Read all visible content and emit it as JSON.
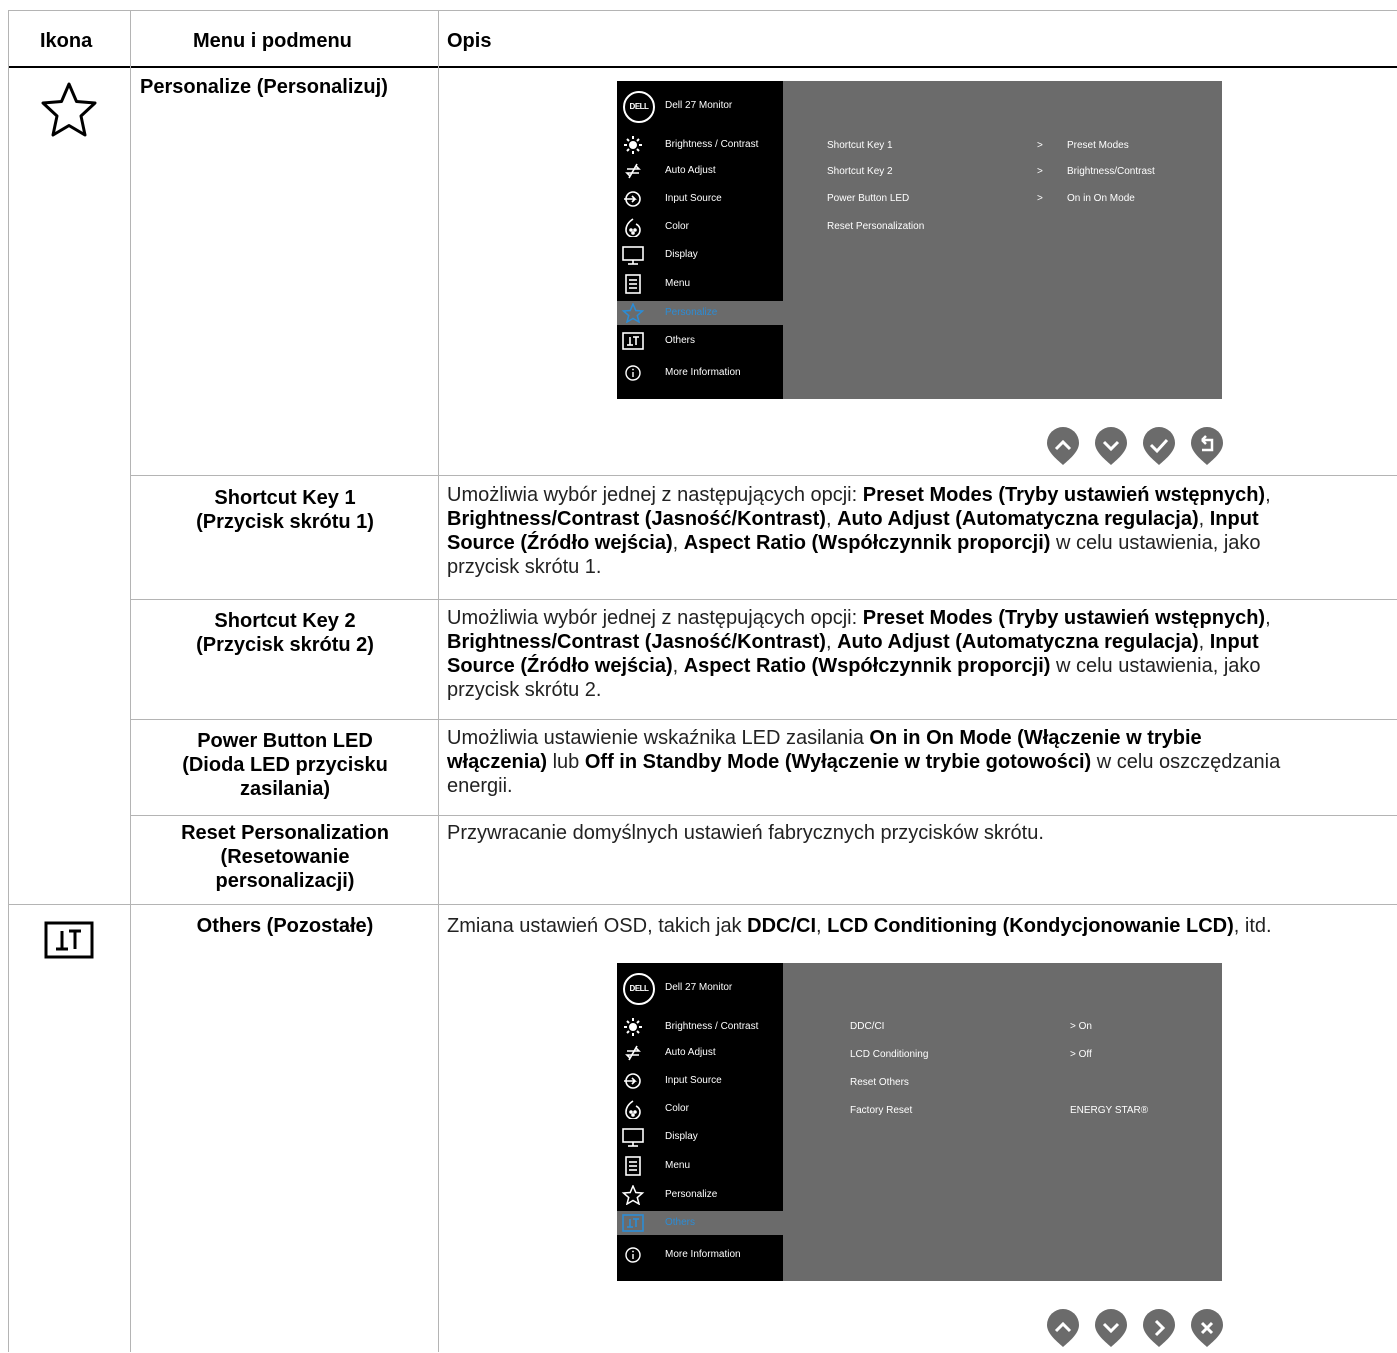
{
  "table": {
    "headers": {
      "icon": "Ikona",
      "menu": "Menu i podmenu",
      "desc": "Opis"
    },
    "personalize": {
      "icon": "star-icon",
      "title": "Personalize (Personalizuj)"
    },
    "rows": [
      {
        "name_l1": "Shortcut Key 1",
        "name_l2": "(Przycisk skrótu 1)",
        "desc_lines": [
          [
            [
              "Umożliwia wybór jednej z następujących opcji: ",
              false
            ],
            [
              "Preset Modes (Tryby ustawień wstępnych)",
              true
            ],
            [
              ",",
              false
            ]
          ],
          [
            [
              "Brightness/Contrast (Jasność/Kontrast)",
              true
            ],
            [
              ", ",
              false
            ],
            [
              "Auto Adjust (Automatyczna regulacja)",
              true
            ],
            [
              ", ",
              false
            ],
            [
              "Input",
              true
            ]
          ],
          [
            [
              "Source (Źródło wejścia)",
              true
            ],
            [
              ", ",
              false
            ],
            [
              "Aspect Ratio (Współczynnik proporcji)",
              true
            ],
            [
              " w celu ustawienia, jako",
              false
            ]
          ],
          [
            [
              "przycisk skrótu 1.",
              false
            ]
          ]
        ]
      },
      {
        "name_l1": "Shortcut Key 2",
        "name_l2": "(Przycisk skrótu 2)",
        "desc_lines": [
          [
            [
              "Umożliwia wybór jednej z następujących opcji: ",
              false
            ],
            [
              "Preset Modes (Tryby ustawień wstępnych)",
              true
            ],
            [
              ",",
              false
            ]
          ],
          [
            [
              "Brightness/Contrast (Jasność/Kontrast)",
              true
            ],
            [
              ", ",
              false
            ],
            [
              "Auto Adjust (Automatyczna regulacja)",
              true
            ],
            [
              ", ",
              false
            ],
            [
              "Input",
              true
            ]
          ],
          [
            [
              "Source (Źródło wejścia)",
              true
            ],
            [
              ", ",
              false
            ],
            [
              "Aspect Ratio (Współczynnik proporcji)",
              true
            ],
            [
              " w celu ustawienia, jako",
              false
            ]
          ],
          [
            [
              "przycisk skrótu 2.",
              false
            ]
          ]
        ]
      },
      {
        "name_l1": "Power Button LED",
        "name_l2": "(Dioda LED przycisku",
        "name_l3": "zasilania)",
        "desc_lines": [
          [
            [
              "Umożliwia ustawienie wskaźnika LED zasilania ",
              false
            ],
            [
              "On in On Mode (Włączenie w trybie",
              true
            ]
          ],
          [
            [
              "włączenia)",
              true
            ],
            [
              " lub ",
              false
            ],
            [
              "Off in Standby Mode (Wyłączenie w trybie gotowości)",
              true
            ],
            [
              " w celu oszczędzania",
              false
            ]
          ],
          [
            [
              "energii.",
              false
            ]
          ]
        ]
      },
      {
        "name_l1": "Reset Personalization",
        "name_l2": "(Resetowanie",
        "name_l3": "personalizacji)",
        "desc_lines": [
          [
            [
              "Przywracanie domyślnych ustawień fabrycznych przycisków skrótu.",
              false
            ]
          ]
        ]
      }
    ],
    "others": {
      "icon": "others-icon",
      "title": "Others (Pozostałe)",
      "desc_lines": [
        [
          [
            "Zmiana ustawień OSD, takich jak ",
            false
          ],
          [
            "DDC/CI",
            true
          ],
          [
            ", ",
            false
          ],
          [
            "LCD Conditioning (Kondycjonowanie LCD)",
            true
          ],
          [
            ", itd.",
            false
          ]
        ]
      ]
    }
  },
  "osd1": {
    "logo": "DELL",
    "title": "Dell 27 Monitor",
    "menu": [
      "Brightness / Contrast",
      "Auto Adjust",
      "Input Source",
      "Color",
      "Display",
      "Menu",
      "Personalize",
      "Others",
      "More Information"
    ],
    "selected_index": 6,
    "options": [
      {
        "label": "Shortcut Key 1",
        "arrow": ">",
        "value": "Preset Modes"
      },
      {
        "label": "Shortcut Key 2",
        "arrow": ">",
        "value": "Brightness/Contrast"
      },
      {
        "label": "Power Button LED",
        "arrow": ">",
        "value": "On in On Mode"
      },
      {
        "label": "Reset Personalization",
        "arrow": "",
        "value": ""
      }
    ],
    "nav_buttons": [
      "up-icon",
      "down-icon",
      "check-icon",
      "back-icon"
    ]
  },
  "osd2": {
    "logo": "DELL",
    "title": "Dell 27 Monitor",
    "menu": [
      "Brightness / Contrast",
      "Auto Adjust",
      "Input Source",
      "Color",
      "Display",
      "Menu",
      "Personalize",
      "Others",
      "More Information"
    ],
    "selected_index": 7,
    "options": [
      {
        "label": "DDC/CI",
        "value": "> On"
      },
      {
        "label": "LCD Conditioning",
        "value": "> Off"
      },
      {
        "label": "Reset Others",
        "value": ""
      },
      {
        "label": "Factory Reset",
        "value": "ENERGY STAR®"
      }
    ],
    "nav_buttons": [
      "up-icon",
      "down-icon",
      "right-icon",
      "close-icon"
    ]
  },
  "colors": {
    "osd_bg": "#6b6b6b",
    "osd_menu_bg": "#000000",
    "osd_selected": "#2b8cd6",
    "nav_button": "#6b6b6b"
  }
}
